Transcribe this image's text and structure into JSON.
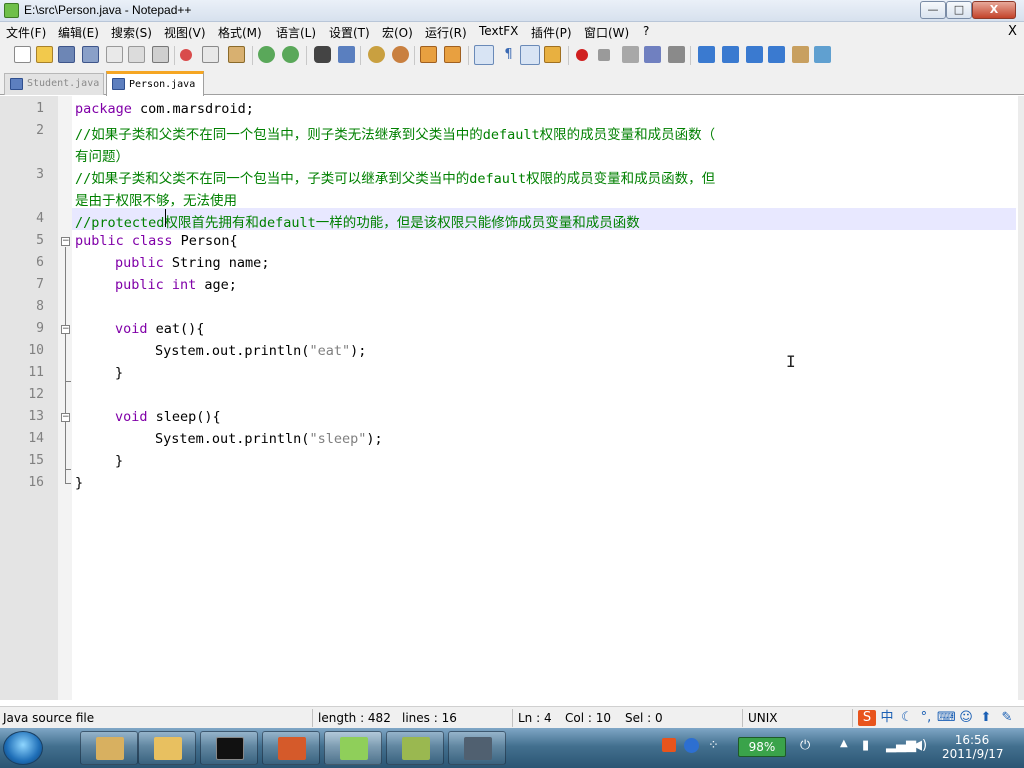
{
  "window": {
    "title": "E:\\src\\Person.java - Notepad++",
    "min_label": "—",
    "max_label": "□",
    "close_label": "X"
  },
  "menu": {
    "items": [
      "文件(F)",
      "编辑(E)",
      "搜索(S)",
      "视图(V)",
      "格式(M)",
      "语言(L)",
      "设置(T)",
      "宏(O)",
      "运行(R)",
      "TextFX",
      "插件(P)",
      "窗口(W)",
      "?"
    ],
    "close_label": "X"
  },
  "tabs": [
    {
      "label": "Student.java",
      "active": false
    },
    {
      "label": "Person.java",
      "active": true
    }
  ],
  "editor": {
    "line_numbers": [
      "1",
      "2",
      "3",
      "4",
      "5",
      "6",
      "7",
      "8",
      "9",
      "10",
      "11",
      "12",
      "13",
      "14",
      "15",
      "16"
    ],
    "lines": {
      "l1_kw": "package",
      "l1_rest": " com.marsdroid;",
      "l2a": "//如果子类和父类不在同一个包当中，则子类无法继承到父类当中的default权限的成员变量和成员函数（",
      "l2b": "有问题）",
      "l3a": "//如果子类和父类不在同一个包当中，子类可以继承到父类当中的default权限的成员变量和成员函数，但",
      "l3b": "是由于权限不够，无法使用",
      "l4": "//protected权限首先拥有和default一样的功能，但是该权限只能修饰成员变量和成员函数",
      "l5_kw": "public class",
      "l5_rest": " Person{",
      "l6_kw": "public",
      "l6_rest": " String name;",
      "l7_kw": "public int",
      "l7_rest": " age;",
      "l9_kw": "void",
      "l9_rest": " eat(){",
      "l10_a": "System.out.println(",
      "l10_str": "\"eat\"",
      "l10_b": ");",
      "l11": "}",
      "l13_kw": "void",
      "l13_rest": " sleep(){",
      "l14_a": "System.out.println(",
      "l14_str": "\"sleep\"",
      "l14_b": ");",
      "l15": "}",
      "l16": "}"
    }
  },
  "status": {
    "file_type": "Java source file",
    "length": "length : 482",
    "lines": "lines : 16",
    "ln": "Ln : 4",
    "col": "Col : 10",
    "sel": "Sel : 0",
    "eol": "UNIX",
    "ime_label": "中"
  },
  "taskbar": {
    "battery": "98%",
    "time": "16:56",
    "date": "2011/9/17"
  },
  "colors": {
    "keyword": "#8000a8",
    "comment": "#008000",
    "string": "#808080",
    "current_line": "#e8e8ff",
    "active_tab_accent": "#f5a623"
  }
}
